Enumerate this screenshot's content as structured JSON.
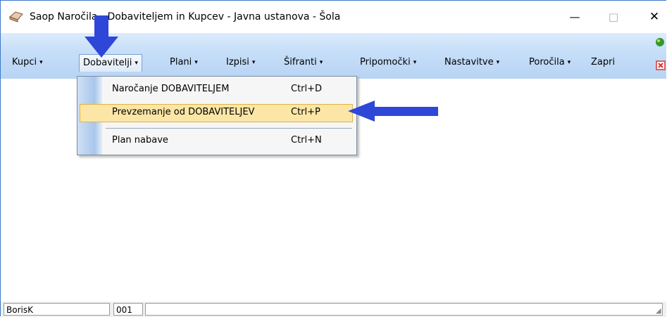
{
  "window": {
    "title": "Saop Naročila - Dobaviteljem in Kupcev - Javna ustanova - Šola",
    "controls": {
      "minimize": "—",
      "maximize": "□",
      "close": "✕"
    }
  },
  "menu": {
    "items": [
      {
        "label": "Kupci",
        "caret": "▾"
      },
      {
        "label": "Dobavitelji",
        "caret": "▾"
      },
      {
        "label": "Plani",
        "caret": "▾"
      },
      {
        "label": "Izpisi",
        "caret": "▾"
      },
      {
        "label": "Šifranti",
        "caret": "▾"
      },
      {
        "label": "Pripomočki",
        "caret": "▾"
      },
      {
        "label": "Nastavitve",
        "caret": "▾"
      },
      {
        "label": "Poročila",
        "caret": "▾"
      },
      {
        "label": "Zapri",
        "caret": ""
      }
    ]
  },
  "dropdown": {
    "items": [
      {
        "label": "Naročanje DOBAVITELJEM",
        "shortcut": "Ctrl+D"
      },
      {
        "label": "Prevzemanje od DOBAVITELJEV",
        "shortcut": "Ctrl+P"
      },
      {
        "label": "Plan nabave",
        "shortcut": "Ctrl+N"
      }
    ]
  },
  "statusbar": {
    "user": "BorisK",
    "code": "001",
    "rest": ""
  },
  "colors": {
    "arrow": "#2f47d8",
    "highlight": "#fbe6a6",
    "menubar": "#c6def8"
  },
  "icons": [
    "app-icon",
    "green-icon",
    "close-doc-icon",
    "arrow-down-annotation",
    "arrow-left-annotation"
  ]
}
